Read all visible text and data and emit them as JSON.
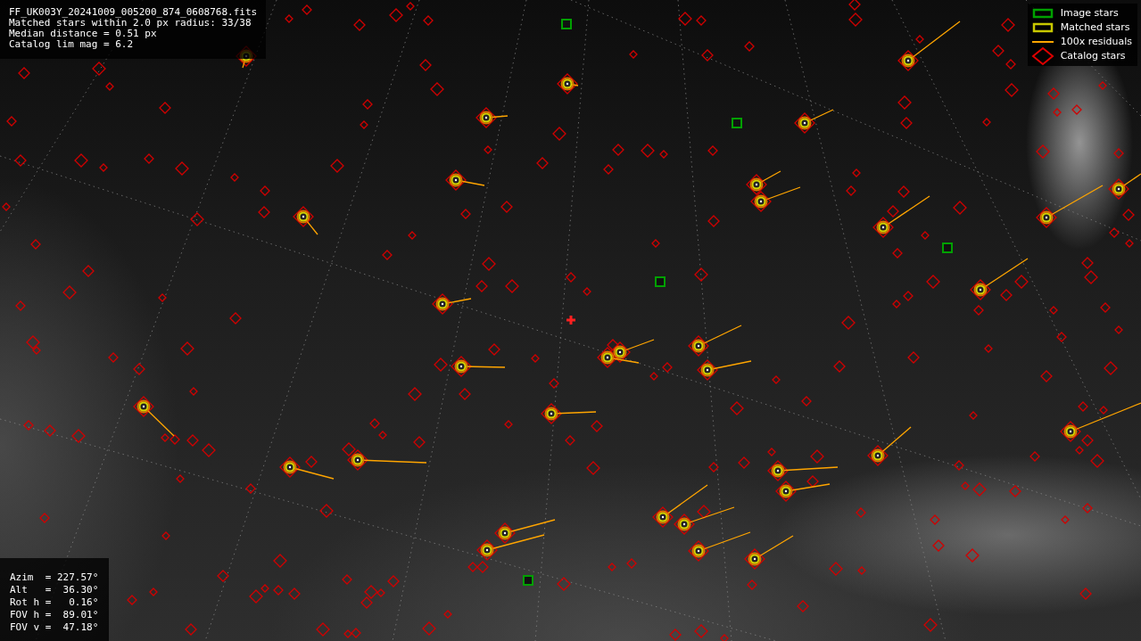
{
  "info_panel": {
    "lines": [
      "FF_UK003Y_20241009_005200_874_0608768.fits",
      "Matched stars within 2.0 px radius: 33/38",
      "Median distance = 0.51 px",
      "Catalog lim mag = 6.2"
    ]
  },
  "legend": {
    "items": [
      {
        "kind": "box",
        "label": "Image stars",
        "color": "#00a000"
      },
      {
        "kind": "box",
        "label": "Matched stars",
        "color": "#c8c800"
      },
      {
        "kind": "line",
        "label": "100x residuals",
        "color": "#ffa500"
      },
      {
        "kind": "diamond",
        "label": "Catalog stars",
        "color": "#dd0000"
      }
    ]
  },
  "pointing_panel": {
    "lines": [
      "Azim  = 227.57°",
      "Alt   =  36.30°",
      "Rot h =   0.16°",
      "FOV h =  89.01°",
      "FOV v =  47.18°"
    ]
  }
}
